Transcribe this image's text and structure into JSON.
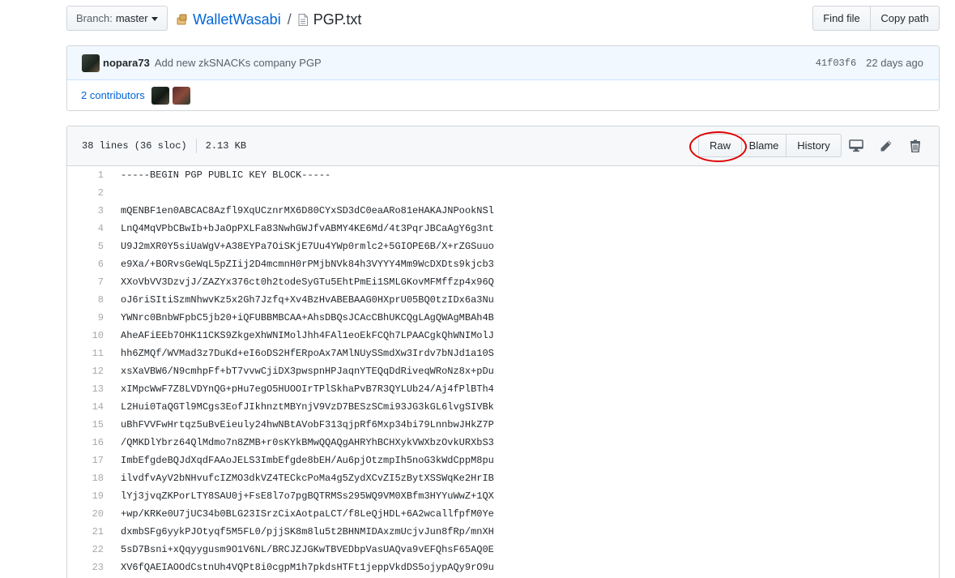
{
  "branch": {
    "prefix": "Branch:",
    "name": "master"
  },
  "breadcrumb": {
    "repo": "WalletWasabi",
    "separator": "/",
    "file": "PGP.txt"
  },
  "top_actions": {
    "find_file": "Find file",
    "copy_path": "Copy path"
  },
  "commit": {
    "author": "nopara73",
    "message": "Add new zkSNACKs company PGP",
    "sha": "41f03f6",
    "time": "22 days ago",
    "contributors": "2 contributors"
  },
  "file": {
    "lines_info": "38 lines (36 sloc)",
    "size": "2.13 KB",
    "raw_label": "Raw",
    "blame_label": "Blame",
    "history_label": "History"
  },
  "code_lines": [
    {
      "n": "1",
      "t": "-----BEGIN PGP PUBLIC KEY BLOCK-----"
    },
    {
      "n": "2",
      "t": ""
    },
    {
      "n": "3",
      "t": "mQENBF1en0ABCAC8Azfl9XqUCznrMX6D80CYxSD3dC0eaARo81eHAKAJNPookNSl"
    },
    {
      "n": "4",
      "t": "LnQ4MqVPbCBwIb+bJaOpPXLFa83NwhGWJfvABMY4KE6Md/4t3PqrJBCaAgY6g3nt"
    },
    {
      "n": "5",
      "t": "U9J2mXR0Y5siUaWgV+A38EYPa7OiSKjE7Uu4YWp0rmlc2+5GIOPE6B/X+rZGSuuo"
    },
    {
      "n": "6",
      "t": "e9Xa/+BORvsGeWqL5pZIij2D4mcmnH0rPMjbNVk84h3VYYY4Mm9WcDXDts9kjcb3"
    },
    {
      "n": "7",
      "t": "XXoVbVV3DzvjJ/ZAZYx376ct0h2todeSyGTu5EhtPmEi1SMLGKovMFMffzp4x96Q"
    },
    {
      "n": "8",
      "t": "oJ6riSItiSzmNhwvKz5x2Gh7Jzfq+Xv4BzHvABEBAAG0HXprU05BQ0tzIDx6a3Nu"
    },
    {
      "n": "9",
      "t": "YWNrc0BnbWFpbC5jb20+iQFUBBMBCAA+AhsDBQsJCAcCBhUKCQgLAgQWAgMBAh4B"
    },
    {
      "n": "10",
      "t": "AheAFiEEb7OHK11CKS9ZkgeXhWNIMolJhh4FAl1eoEkFCQh7LPAACgkQhWNIMolJ"
    },
    {
      "n": "11",
      "t": "hh6ZMQf/WVMad3z7DuKd+eI6oDS2HfERpoAx7AMlNUySSmdXw3Irdv7bNJd1a10S"
    },
    {
      "n": "12",
      "t": "xsXaVBW6/N9cmhpFf+bT7vvwCjiDX3pwspnHPJaqnYTEQqDdRiveqWRoNz8x+pDu"
    },
    {
      "n": "13",
      "t": "xIMpcWwF7Z8LVDYnQG+pHu7egO5HUOOIrTPlSkhaPvB7R3QYLUb24/Aj4fPlBTh4"
    },
    {
      "n": "14",
      "t": "L2Hui0TaQGTl9MCgs3EofJIkhnztMBYnjV9VzD7BESzSCmi93JG3kGL6lvgSIVBk"
    },
    {
      "n": "15",
      "t": "uBhFVVFwHrtqz5uBvEieuly24hwNBtAVobF313qjpRf6Mxp34bi79LnnbwJHkZ7P"
    },
    {
      "n": "16",
      "t": "/QMKDlYbrz64QlMdmo7n8ZMB+r0sKYkBMwQQAQgAHRYhBCHXykVWXbzOvkURXbS3"
    },
    {
      "n": "17",
      "t": "ImbEfgdeBQJdXqdFAAoJELS3ImbEfgde8bEH/Au6pjOtzmpIh5noG3kWdCppM8pu"
    },
    {
      "n": "18",
      "t": "ilvdfvAyV2bNHvufcIZMO3dkVZ4TECkcPoMa4g5ZydXCvZI5zBytXSSWqKe2HrIB"
    },
    {
      "n": "19",
      "t": "lYj3jvqZKPorLTY8SAU0j+FsE8l7o7pgBQTRMSs295WQ9VM0XBfm3HYYuWwZ+1QX"
    },
    {
      "n": "20",
      "t": "+wp/KRKe0U7jUC34b0BLG23ISrzCixAotpaLCT/f8LeQjHDL+6A2wcallfpfM0Ye"
    },
    {
      "n": "21",
      "t": "dxmbSFg6yykPJOtyqf5M5FL0/pjjSK8m8lu5t2BHNMIDAxzmUcjvJun8fRp/mnXH"
    },
    {
      "n": "22",
      "t": "5sD7Bsni+xQqyygusm9O1V6NL/BRCJZJGKwTBVEDbpVasUAQva9vEFQhsF65AQ0E"
    },
    {
      "n": "23",
      "t": "XV6fQAEIAOOdCstnUh4VQPt8i0cgpM1h7pkdsHTFt1jeppVkdDS5ojypAQy9rO9u"
    }
  ]
}
